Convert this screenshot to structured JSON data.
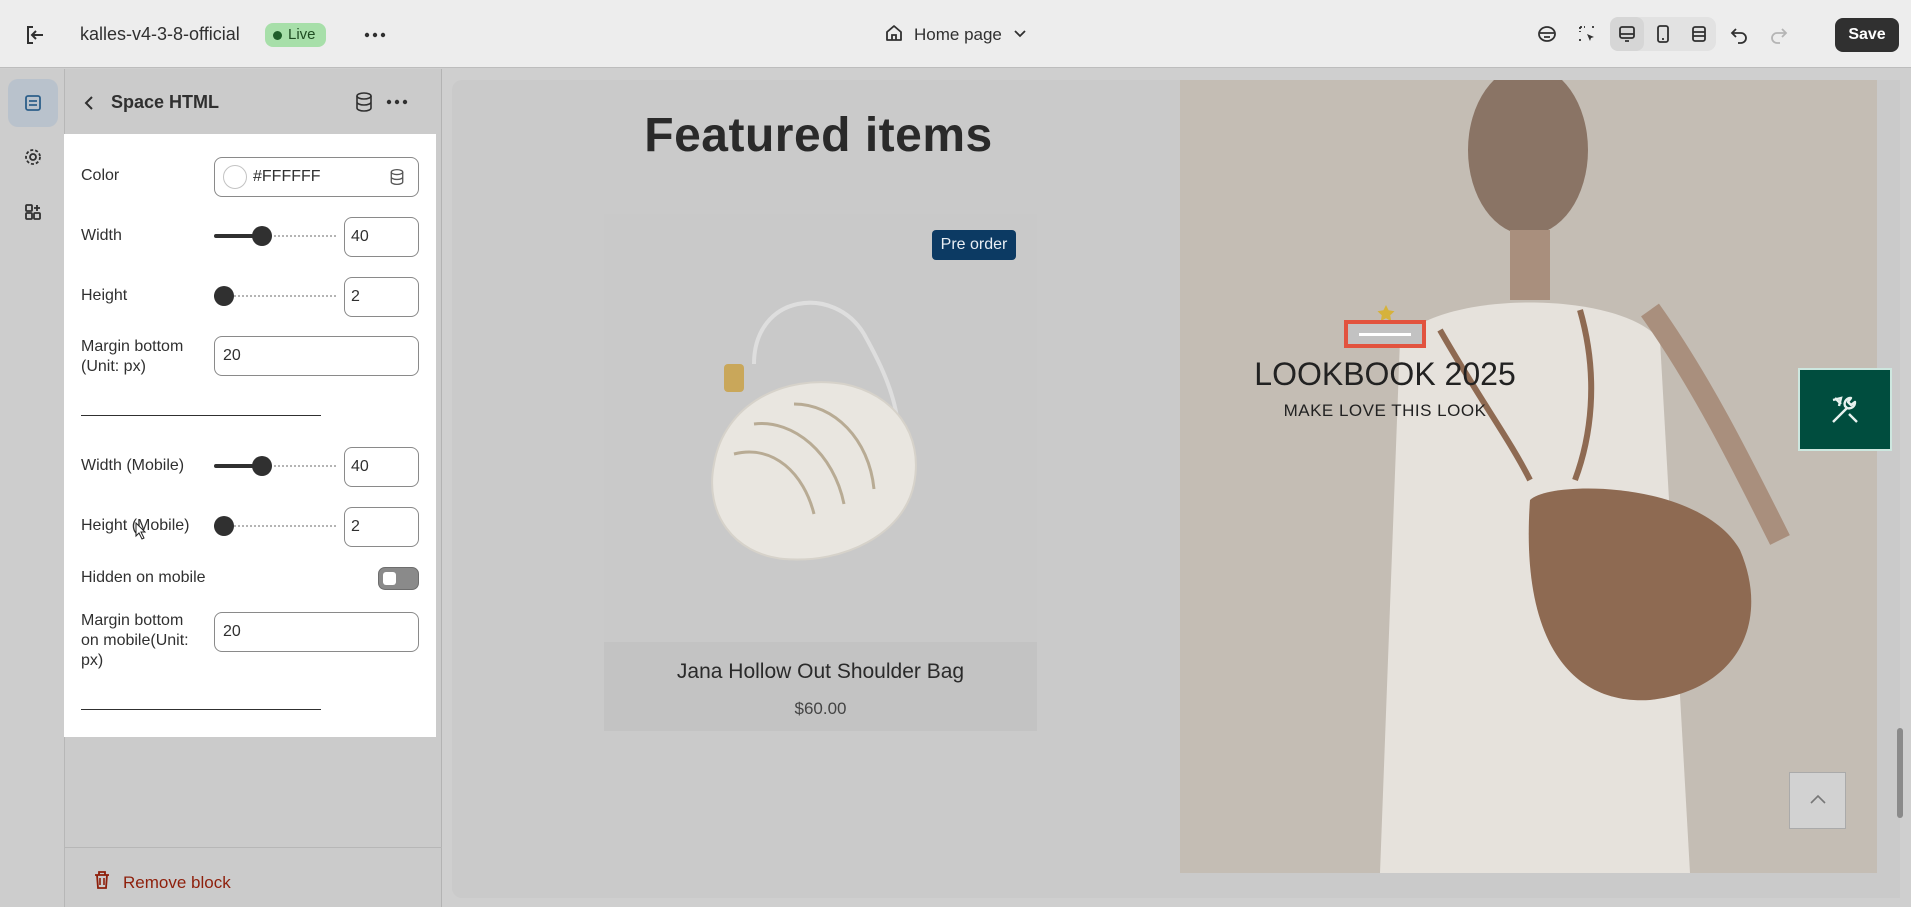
{
  "topbar": {
    "store_name": "kalles-v4-3-8-official",
    "status_badge": "Live",
    "page_selector": "Home page",
    "save_label": "Save"
  },
  "panel": {
    "title": "Space HTML",
    "fields": {
      "color_label": "Color",
      "color_value": "#FFFFFF",
      "width_label": "Width",
      "width_value": "40",
      "height_label": "Height",
      "height_value": "2",
      "margin_bottom_label": "Margin bottom (Unit: px)",
      "margin_bottom_value": "20",
      "width_mobile_label": "Width (Mobile)",
      "width_mobile_value": "40",
      "height_mobile_label": "Height (Mobile)",
      "height_mobile_value": "2",
      "hidden_mobile_label": "Hidden on mobile",
      "hidden_mobile_on": false,
      "margin_bottom_mobile_label": "Margin bottom on mobile(Unit: px)",
      "margin_bottom_mobile_value": "20"
    },
    "remove_label": "Remove block"
  },
  "preview": {
    "featured_title": "Featured items",
    "product": {
      "badge": "Pre order",
      "name": "Jana Hollow Out Shoulder Bag",
      "price": "$60.00"
    },
    "lookbook": {
      "title": "LOOKBOOK 2025",
      "subtitle": "MAKE LOVE THIS LOOK"
    }
  },
  "colors": {
    "save_bg": "#303030",
    "live_badge": "#a7dfa9",
    "preorder_badge": "#0c3a63",
    "highlight_outline": "#e2533f",
    "tool_button": "#004d3e",
    "remove_text": "#8e1f0b"
  },
  "icons": {
    "exit": "exit-icon",
    "more": "more-horizontal-icon",
    "home": "home-icon",
    "chevron": "chevron-down-icon",
    "sections": "sections-icon",
    "settings": "gear-icon",
    "apps": "apps-icon",
    "database": "database-icon",
    "trash": "trash-icon",
    "tools": "tools-icon"
  }
}
